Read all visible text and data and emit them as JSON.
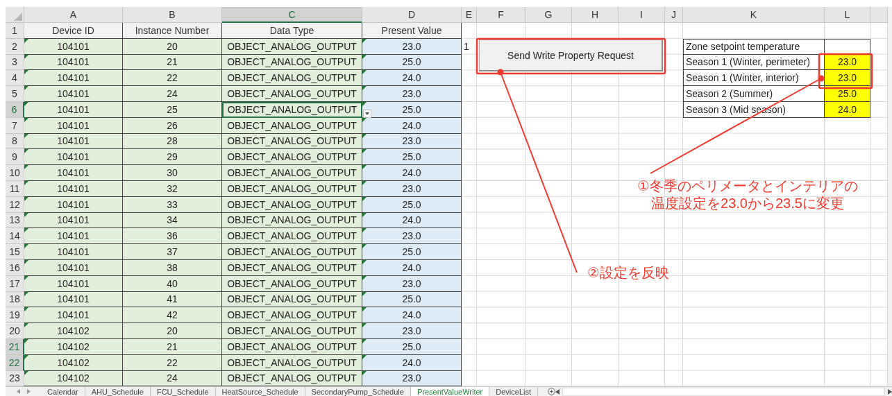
{
  "columns": [
    {
      "letter": "A",
      "selected": false
    },
    {
      "letter": "B",
      "selected": false
    },
    {
      "letter": "C",
      "selected": true
    },
    {
      "letter": "D",
      "selected": false
    },
    {
      "letter": "E",
      "selected": false
    },
    {
      "letter": "F",
      "selected": false
    },
    {
      "letter": "G",
      "selected": false
    },
    {
      "letter": "H",
      "selected": false
    },
    {
      "letter": "I",
      "selected": false
    },
    {
      "letter": "J",
      "selected": false
    },
    {
      "letter": "K",
      "selected": false
    },
    {
      "letter": "L",
      "selected": false
    }
  ],
  "row_headers": [
    {
      "label": "1",
      "selected": false
    },
    {
      "label": "2",
      "selected": false
    },
    {
      "label": "3",
      "selected": false
    },
    {
      "label": "4",
      "selected": false
    },
    {
      "label": "5",
      "selected": false
    },
    {
      "label": "6",
      "selected": true
    },
    {
      "label": "7",
      "selected": false
    },
    {
      "label": "8",
      "selected": false
    },
    {
      "label": "9",
      "selected": false
    },
    {
      "label": "10",
      "selected": false
    },
    {
      "label": "11",
      "selected": false
    },
    {
      "label": "12",
      "selected": false
    },
    {
      "label": "13",
      "selected": false
    },
    {
      "label": "14",
      "selected": false
    },
    {
      "label": "15",
      "selected": false
    },
    {
      "label": "16",
      "selected": false
    },
    {
      "label": "17",
      "selected": false
    },
    {
      "label": "18",
      "selected": false
    },
    {
      "label": "19",
      "selected": false
    },
    {
      "label": "20",
      "selected": false
    },
    {
      "label": "21",
      "selected": true
    },
    {
      "label": "22",
      "selected": true
    },
    {
      "label": "23",
      "selected": false
    }
  ],
  "header_row": [
    "Device ID",
    "Instance Number",
    "Data Type",
    "Present Value"
  ],
  "rows": [
    {
      "device_id": "104101",
      "instance_number": "20",
      "data_type": "OBJECT_ANALOG_OUTPUT",
      "present_value": "23.0",
      "flagged": true,
      "active": false
    },
    {
      "device_id": "104101",
      "instance_number": "21",
      "data_type": "OBJECT_ANALOG_OUTPUT",
      "present_value": "25.0",
      "flagged": true,
      "active": false
    },
    {
      "device_id": "104101",
      "instance_number": "22",
      "data_type": "OBJECT_ANALOG_OUTPUT",
      "present_value": "24.0",
      "flagged": true,
      "active": false
    },
    {
      "device_id": "104101",
      "instance_number": "24",
      "data_type": "OBJECT_ANALOG_OUTPUT",
      "present_value": "23.0",
      "flagged": true,
      "active": false
    },
    {
      "device_id": "104101",
      "instance_number": "25",
      "data_type": "OBJECT_ANALOG_OUTPUT",
      "present_value": "25.0",
      "flagged": true,
      "active": true
    },
    {
      "device_id": "104101",
      "instance_number": "26",
      "data_type": "OBJECT_ANALOG_OUTPUT",
      "present_value": "24.0",
      "flagged": true,
      "active": false
    },
    {
      "device_id": "104101",
      "instance_number": "28",
      "data_type": "OBJECT_ANALOG_OUTPUT",
      "present_value": "23.0",
      "flagged": true,
      "active": false
    },
    {
      "device_id": "104101",
      "instance_number": "29",
      "data_type": "OBJECT_ANALOG_OUTPUT",
      "present_value": "25.0",
      "flagged": true,
      "active": false
    },
    {
      "device_id": "104101",
      "instance_number": "30",
      "data_type": "OBJECT_ANALOG_OUTPUT",
      "present_value": "24.0",
      "flagged": true,
      "active": false
    },
    {
      "device_id": "104101",
      "instance_number": "32",
      "data_type": "OBJECT_ANALOG_OUTPUT",
      "present_value": "23.0",
      "flagged": true,
      "active": false
    },
    {
      "device_id": "104101",
      "instance_number": "33",
      "data_type": "OBJECT_ANALOG_OUTPUT",
      "present_value": "25.0",
      "flagged": true,
      "active": false
    },
    {
      "device_id": "104101",
      "instance_number": "34",
      "data_type": "OBJECT_ANALOG_OUTPUT",
      "present_value": "24.0",
      "flagged": true,
      "active": false
    },
    {
      "device_id": "104101",
      "instance_number": "36",
      "data_type": "OBJECT_ANALOG_OUTPUT",
      "present_value": "23.0",
      "flagged": true,
      "active": false
    },
    {
      "device_id": "104101",
      "instance_number": "37",
      "data_type": "OBJECT_ANALOG_OUTPUT",
      "present_value": "25.0",
      "flagged": true,
      "active": false
    },
    {
      "device_id": "104101",
      "instance_number": "38",
      "data_type": "OBJECT_ANALOG_OUTPUT",
      "present_value": "24.0",
      "flagged": true,
      "active": false
    },
    {
      "device_id": "104101",
      "instance_number": "40",
      "data_type": "OBJECT_ANALOG_OUTPUT",
      "present_value": "23.0",
      "flagged": true,
      "active": false
    },
    {
      "device_id": "104101",
      "instance_number": "41",
      "data_type": "OBJECT_ANALOG_OUTPUT",
      "present_value": "25.0",
      "flagged": true,
      "active": false
    },
    {
      "device_id": "104101",
      "instance_number": "42",
      "data_type": "OBJECT_ANALOG_OUTPUT",
      "present_value": "24.0",
      "flagged": true,
      "active": false
    },
    {
      "device_id": "104102",
      "instance_number": "20",
      "data_type": "OBJECT_ANALOG_OUTPUT",
      "present_value": "23.0",
      "flagged": true,
      "active": false
    },
    {
      "device_id": "104102",
      "instance_number": "21",
      "data_type": "OBJECT_ANALOG_OUTPUT",
      "present_value": "25.0",
      "flagged": true,
      "active": false
    },
    {
      "device_id": "104102",
      "instance_number": "22",
      "data_type": "OBJECT_ANALOG_OUTPUT",
      "present_value": "24.0",
      "flagged": true,
      "active": false
    },
    {
      "device_id": "104102",
      "instance_number": "24",
      "data_type": "OBJECT_ANALOG_OUTPUT",
      "present_value": "23.0",
      "flagged": true,
      "active": false
    }
  ],
  "row_marker": "1",
  "setpoint_table": [
    {
      "label": "Zone setpoint temperature",
      "highlighted": false
    },
    {
      "label": "Season 1 (Winter, perimeter)",
      "value": "23.0",
      "highlighted": true
    },
    {
      "label": "Season 1 (Winter, interior)",
      "value": "23.0",
      "highlighted": true
    },
    {
      "label": "Season 2 (Summer)",
      "value": "25.0",
      "highlighted": true
    },
    {
      "label": "Season 3 (Mid season)",
      "value": "24.0",
      "highlighted": true
    }
  ],
  "button": {
    "label": "Send Write Property Request"
  },
  "annotations": [
    "①冬季のペリメータとインテリアの温度設定を23.0から23.5に変更",
    "②設定を反映"
  ],
  "sheet_tabs": [
    {
      "label": "Calendar",
      "selected": false
    },
    {
      "label": "AHU_Schedule",
      "selected": false
    },
    {
      "label": "FCU_Schedule",
      "selected": false
    },
    {
      "label": "HeatSource_Schedule",
      "selected": false
    },
    {
      "label": "SecondaryPump_Schedule",
      "selected": false
    },
    {
      "label": "PresentValueWriter",
      "selected": true
    },
    {
      "label": "DeviceList",
      "selected": false
    }
  ]
}
